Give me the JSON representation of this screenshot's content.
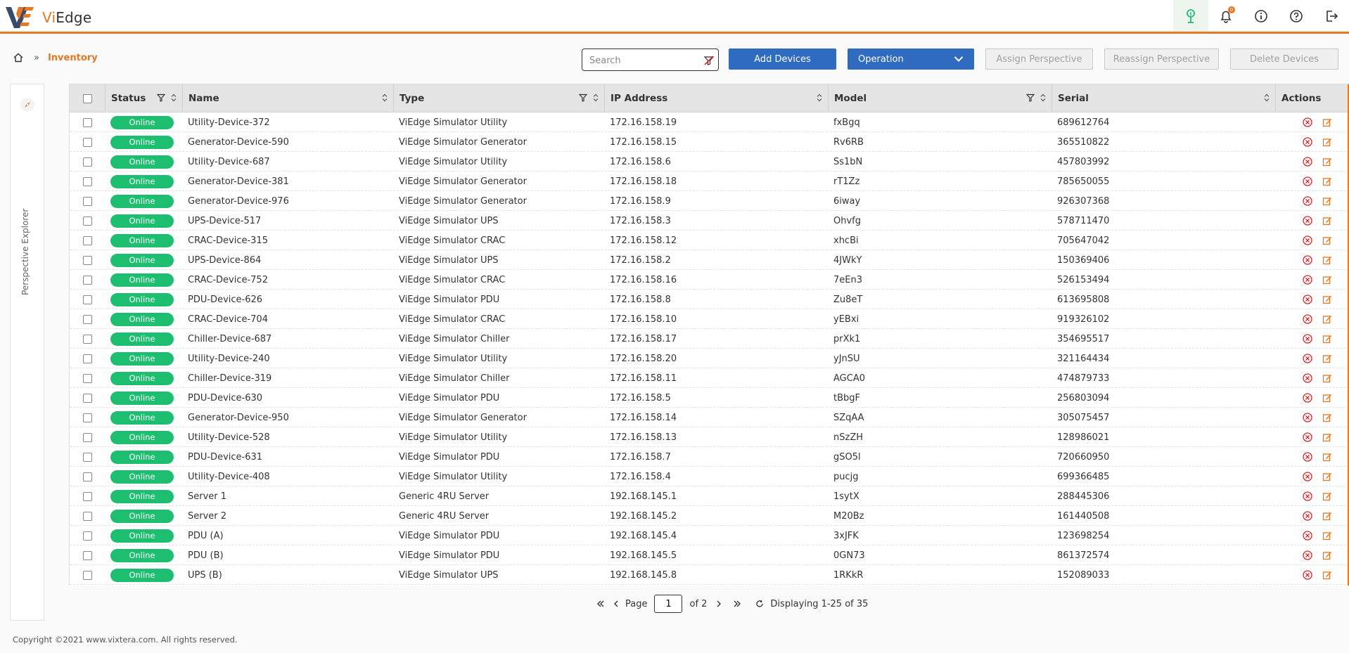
{
  "app": {
    "brand_prefix": "Vi",
    "brand_suffix": "Edge"
  },
  "header_icons": [
    "tree-icon",
    "bell-icon",
    "info-icon",
    "help-icon",
    "logout-icon"
  ],
  "notification_count": "0",
  "breadcrumb": {
    "current": "Inventory"
  },
  "toolbar": {
    "search_placeholder": "Search",
    "add_devices": "Add Devices",
    "operation": "Operation",
    "assign_perspective": "Assign Perspective",
    "reassign_perspective": "Reassign Perspective",
    "delete_devices": "Delete Devices"
  },
  "side_panel": {
    "label": "Perspective Explorer"
  },
  "table": {
    "columns": {
      "status": "Status",
      "name": "Name",
      "type": "Type",
      "ip": "IP Address",
      "model": "Model",
      "serial": "Serial",
      "actions": "Actions"
    },
    "rows": [
      {
        "status": "Online",
        "name": "Utility-Device-372",
        "type": "ViEdge Simulator Utility",
        "ip": "172.16.158.19",
        "model": "fxBgq",
        "serial": "689612764"
      },
      {
        "status": "Online",
        "name": "Generator-Device-590",
        "type": "ViEdge Simulator Generator",
        "ip": "172.16.158.15",
        "model": "Rv6RB",
        "serial": "365510822"
      },
      {
        "status": "Online",
        "name": "Utility-Device-687",
        "type": "ViEdge Simulator Utility",
        "ip": "172.16.158.6",
        "model": "Ss1bN",
        "serial": "457803992"
      },
      {
        "status": "Online",
        "name": "Generator-Device-381",
        "type": "ViEdge Simulator Generator",
        "ip": "172.16.158.18",
        "model": "rT1Zz",
        "serial": "785650055"
      },
      {
        "status": "Online",
        "name": "Generator-Device-976",
        "type": "ViEdge Simulator Generator",
        "ip": "172.16.158.9",
        "model": "6iway",
        "serial": "926307368"
      },
      {
        "status": "Online",
        "name": "UPS-Device-517",
        "type": "ViEdge Simulator UPS",
        "ip": "172.16.158.3",
        "model": "Ohvfg",
        "serial": "578711470"
      },
      {
        "status": "Online",
        "name": "CRAC-Device-315",
        "type": "ViEdge Simulator CRAC",
        "ip": "172.16.158.12",
        "model": "xhcBi",
        "serial": "705647042"
      },
      {
        "status": "Online",
        "name": "UPS-Device-864",
        "type": "ViEdge Simulator UPS",
        "ip": "172.16.158.2",
        "model": "4JWkY",
        "serial": "150369406"
      },
      {
        "status": "Online",
        "name": "CRAC-Device-752",
        "type": "ViEdge Simulator CRAC",
        "ip": "172.16.158.16",
        "model": "7eEn3",
        "serial": "526153494"
      },
      {
        "status": "Online",
        "name": "PDU-Device-626",
        "type": "ViEdge Simulator PDU",
        "ip": "172.16.158.8",
        "model": "Zu8eT",
        "serial": "613695808"
      },
      {
        "status": "Online",
        "name": "CRAC-Device-704",
        "type": "ViEdge Simulator CRAC",
        "ip": "172.16.158.10",
        "model": "yEBxi",
        "serial": "919326102"
      },
      {
        "status": "Online",
        "name": "Chiller-Device-687",
        "type": "ViEdge Simulator Chiller",
        "ip": "172.16.158.17",
        "model": "prXk1",
        "serial": "354695517"
      },
      {
        "status": "Online",
        "name": "Utility-Device-240",
        "type": "ViEdge Simulator Utility",
        "ip": "172.16.158.20",
        "model": "yJnSU",
        "serial": "321164434"
      },
      {
        "status": "Online",
        "name": "Chiller-Device-319",
        "type": "ViEdge Simulator Chiller",
        "ip": "172.16.158.11",
        "model": "AGCA0",
        "serial": "474879733"
      },
      {
        "status": "Online",
        "name": "PDU-Device-630",
        "type": "ViEdge Simulator PDU",
        "ip": "172.16.158.5",
        "model": "tBbgF",
        "serial": "256803094"
      },
      {
        "status": "Online",
        "name": "Generator-Device-950",
        "type": "ViEdge Simulator Generator",
        "ip": "172.16.158.14",
        "model": "SZqAA",
        "serial": "305075457"
      },
      {
        "status": "Online",
        "name": "Utility-Device-528",
        "type": "ViEdge Simulator Utility",
        "ip": "172.16.158.13",
        "model": "nSzZH",
        "serial": "128986021"
      },
      {
        "status": "Online",
        "name": "PDU-Device-631",
        "type": "ViEdge Simulator PDU",
        "ip": "172.16.158.7",
        "model": "gSO5l",
        "serial": "720660950"
      },
      {
        "status": "Online",
        "name": "Utility-Device-408",
        "type": "ViEdge Simulator Utility",
        "ip": "172.16.158.4",
        "model": "pucjg",
        "serial": "699366485"
      },
      {
        "status": "Online",
        "name": "Server 1",
        "type": "Generic 4RU Server",
        "ip": "192.168.145.1",
        "model": "1sytX",
        "serial": "288445306"
      },
      {
        "status": "Online",
        "name": "Server 2",
        "type": "Generic 4RU Server",
        "ip": "192.168.145.2",
        "model": "M20Bz",
        "serial": "161440508"
      },
      {
        "status": "Online",
        "name": "PDU (A)",
        "type": "ViEdge Simulator PDU",
        "ip": "192.168.145.4",
        "model": "3xJFK",
        "serial": "123698254"
      },
      {
        "status": "Online",
        "name": "PDU (B)",
        "type": "ViEdge Simulator PDU",
        "ip": "192.168.145.5",
        "model": "0GN73",
        "serial": "861372574"
      },
      {
        "status": "Online",
        "name": "UPS (B)",
        "type": "ViEdge Simulator UPS",
        "ip": "192.168.145.8",
        "model": "1RKkR",
        "serial": "152089033"
      }
    ]
  },
  "pager": {
    "page_label": "Page",
    "page_value": "1",
    "of_label": "of 2",
    "display_text": "Displaying 1-25 of 35"
  },
  "footer": {
    "copyright": "Copyright ©2021 www.vixtera.com. All rights reserved."
  },
  "colors": {
    "accent": "#e87722",
    "primary": "#2f6bc0",
    "online": "#1ebe70",
    "delete": "#e02424"
  }
}
